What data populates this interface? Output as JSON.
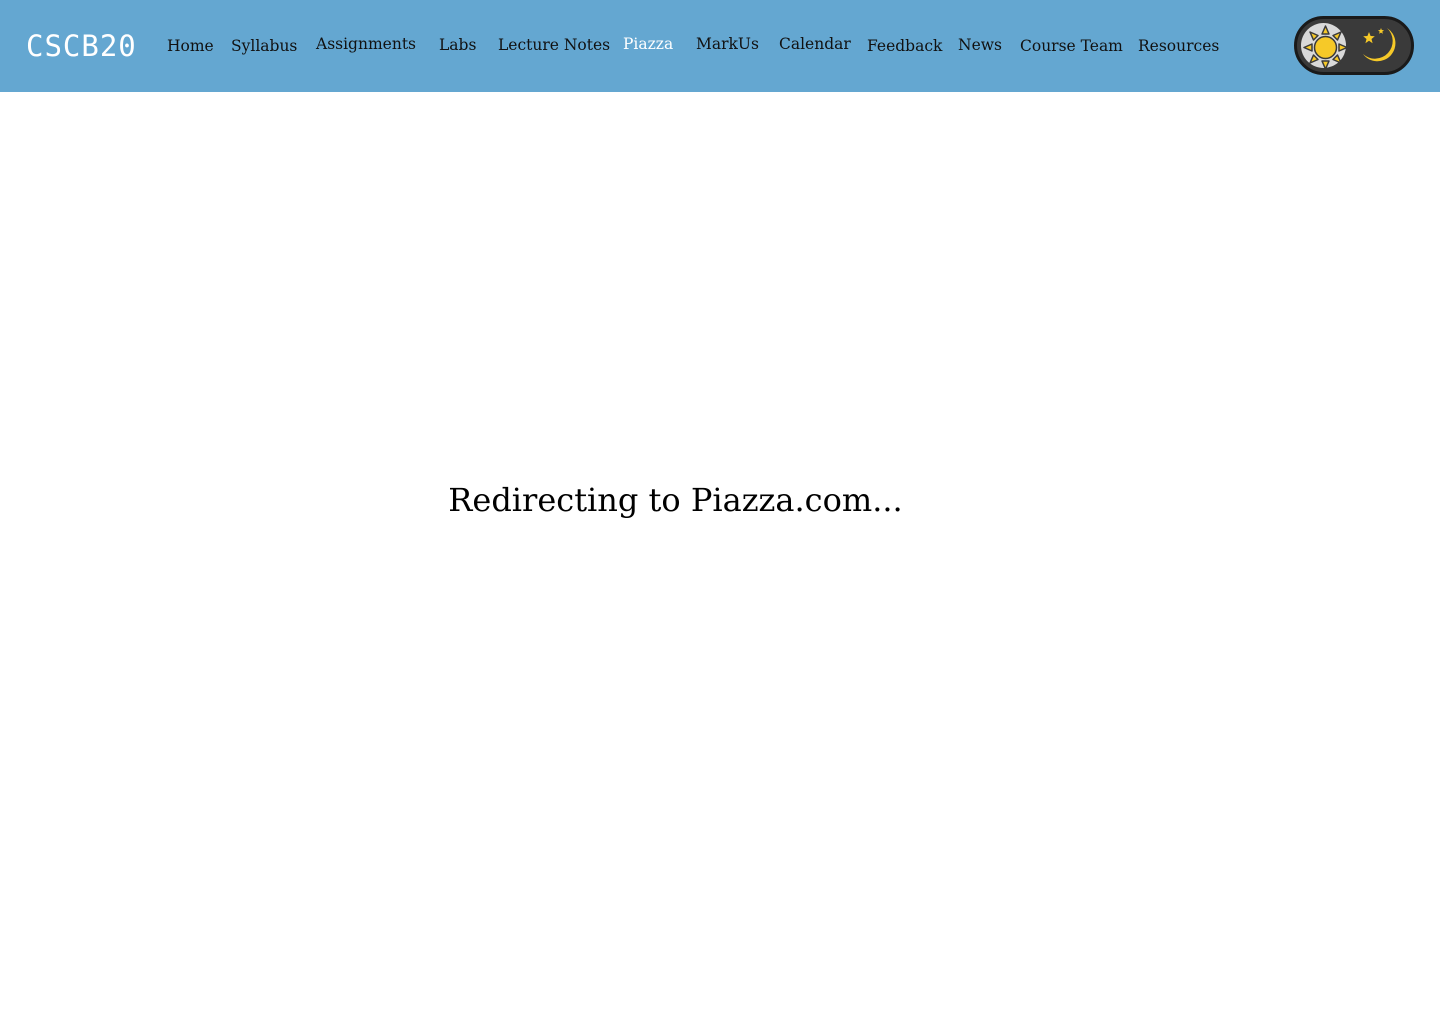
{
  "page_title": "CSCB20",
  "navbar": {
    "brand": "CSCB20",
    "background_color": "#64a7d1",
    "active_color": "#ffffff",
    "items": [
      {
        "label": "Home"
      },
      {
        "label": "Syllabus"
      },
      {
        "label": "Assignments"
      },
      {
        "label": "Labs"
      },
      {
        "label": "Lecture Notes"
      },
      {
        "label": "Piazza",
        "active": true
      },
      {
        "label": "MarkUs"
      },
      {
        "label": "Calendar"
      },
      {
        "label": "Feedback"
      },
      {
        "label": "News"
      },
      {
        "label": "Course Team"
      },
      {
        "label": "Resources"
      }
    ],
    "theme_toggle": {
      "icons": [
        "sun-icon",
        "moon-icon"
      ],
      "selected": "light"
    }
  },
  "main": {
    "message": "Redirecting to Piazza.com..."
  }
}
